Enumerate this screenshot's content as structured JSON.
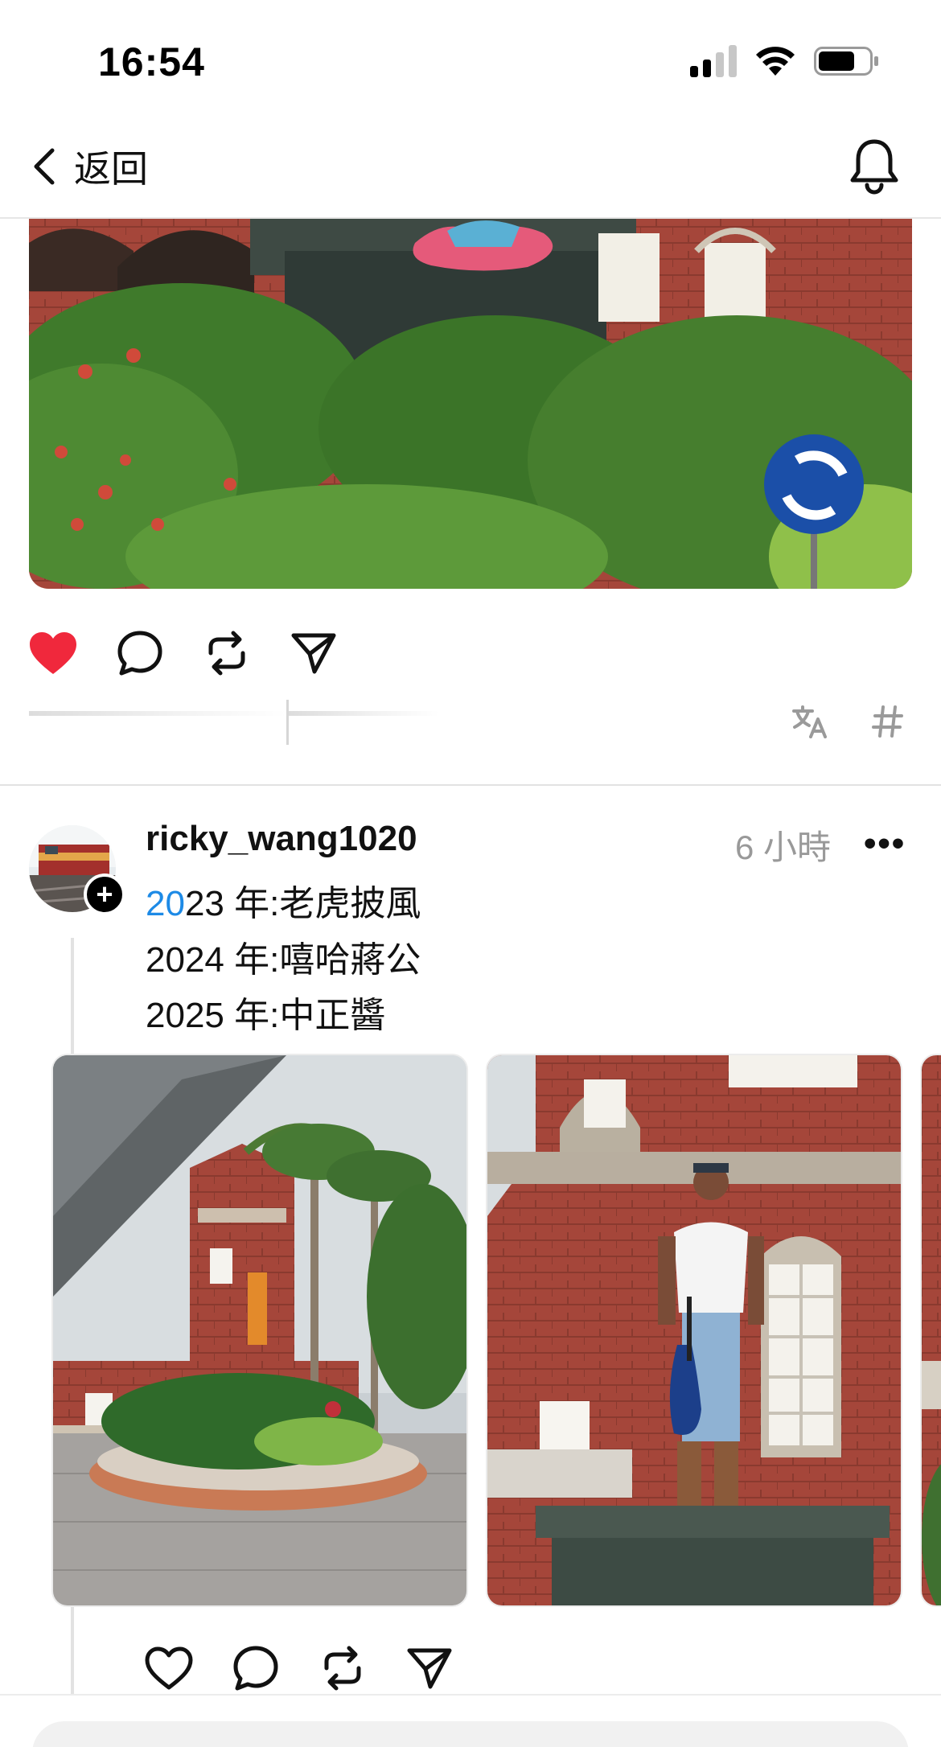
{
  "status_bar": {
    "time": "16:54"
  },
  "nav": {
    "back_label": "返回"
  },
  "post1": {
    "liked": true,
    "like_color": "#f0283c"
  },
  "post2": {
    "username": "ricky_wang1020",
    "time_ago": "6 小時",
    "more": "•••",
    "caption_lines": [
      {
        "highlight": "20",
        "rest": "23 年:老虎披風"
      },
      {
        "highlight": "",
        "rest": "2024 年:嘻哈蔣公"
      },
      {
        "highlight": "",
        "rest": "2025 年:中正醬"
      }
    ],
    "mention_color": "#1d8ae6"
  },
  "icons": {
    "back": "chevron-left-icon",
    "bell": "bell-icon",
    "like": "heart-icon",
    "comment": "comment-icon",
    "repost": "repost-icon",
    "share": "share-icon",
    "translate": "translate-icon",
    "hashtag": "hashtag-icon"
  }
}
